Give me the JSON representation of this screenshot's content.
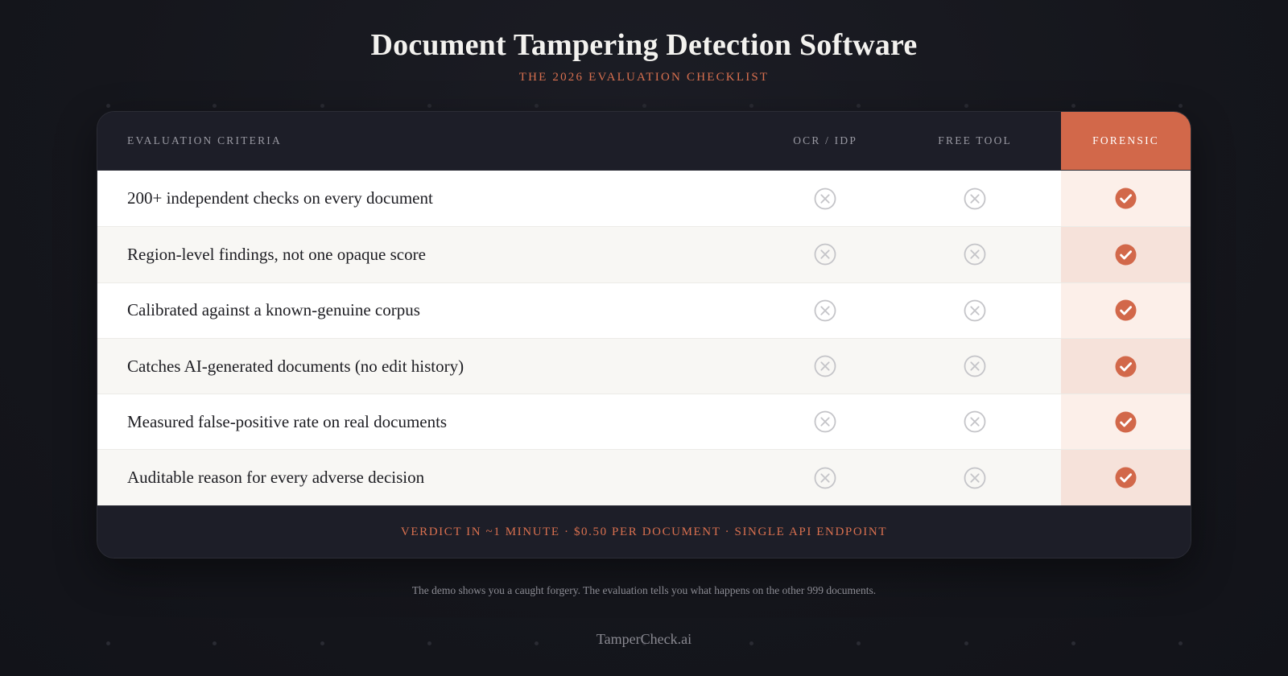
{
  "header": {
    "title": "Document Tampering Detection Software",
    "subtitle": "THE 2026 EVALUATION CHECKLIST"
  },
  "table": {
    "columns": [
      "EVALUATION CRITERIA",
      "OCR / IDP",
      "FREE TOOL",
      "FORENSIC"
    ],
    "rows": [
      {
        "criterion": "200+ independent checks on every document",
        "ocr_idp": "no",
        "free_tool": "no",
        "forensic": "yes"
      },
      {
        "criterion": "Region-level findings, not one opaque score",
        "ocr_idp": "no",
        "free_tool": "no",
        "forensic": "yes"
      },
      {
        "criterion": "Calibrated against a known-genuine corpus",
        "ocr_idp": "no",
        "free_tool": "no",
        "forensic": "yes"
      },
      {
        "criterion": "Catches AI-generated documents (no edit history)",
        "ocr_idp": "no",
        "free_tool": "no",
        "forensic": "yes"
      },
      {
        "criterion": "Measured false-positive rate on real documents",
        "ocr_idp": "no",
        "free_tool": "no",
        "forensic": "yes"
      },
      {
        "criterion": "Auditable reason for every adverse decision",
        "ocr_idp": "no",
        "free_tool": "no",
        "forensic": "yes"
      }
    ],
    "footer": "VERDICT IN ~1 MINUTE · $0.50 PER DOCUMENT · SINGLE API ENDPOINT"
  },
  "note": "The demo shows you a caught forgery. The evaluation tells you what happens on the other 999 documents.",
  "brand": "TamperCheck.ai",
  "icons": {
    "no": "x-circle-icon",
    "yes": "check-circle-icon"
  },
  "colors": {
    "accent": "#d2684a",
    "background": "#15161c",
    "panel": "#1d1e28"
  }
}
